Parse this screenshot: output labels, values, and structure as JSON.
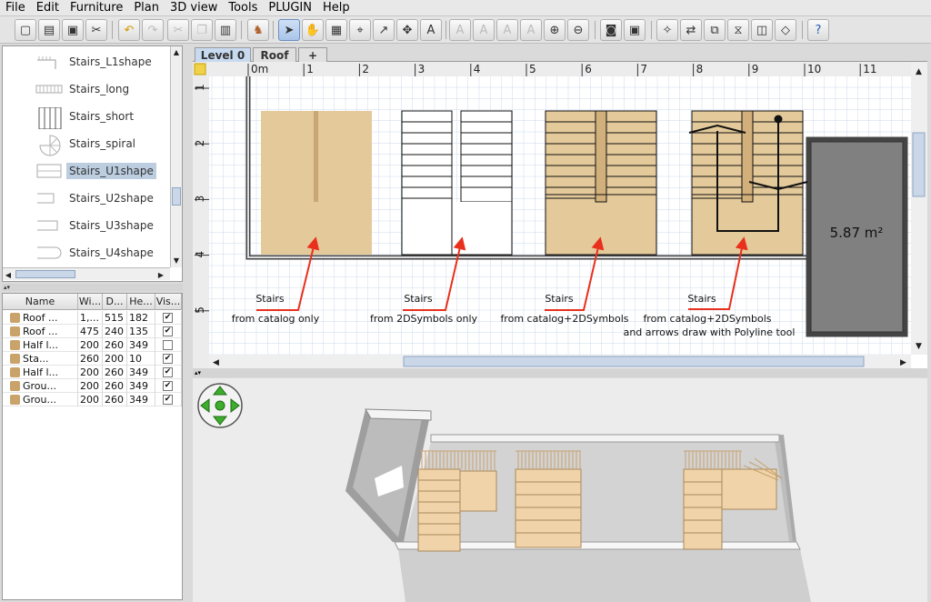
{
  "menu": [
    "File",
    "Edit",
    "Furniture",
    "Plan",
    "3D view",
    "Tools",
    "PLUGIN",
    "Help"
  ],
  "toolbar_icons": [
    "new-file-icon",
    "open-icon",
    "save-icon",
    "cut-preferences-icon",
    "undo-icon",
    "redo-icon",
    "cut-icon",
    "copy-icon",
    "paste-icon",
    "add-furniture-icon",
    "select-arrow-icon",
    "pan-hand-icon",
    "create-rooms-icon",
    "create-polylines-icon",
    "create-dimension-icon",
    "create-labels-icon",
    "add-text-icon",
    "text-bold-icon",
    "text-italic-icon",
    "enlarge-text-icon",
    "reduce-text-icon",
    "zoom-in-icon",
    "zoom-out-icon",
    "create-photo-icon",
    "create-video-icon",
    "import-furniture-icon",
    "import-texture-icon",
    "flip-icon",
    "mirror-icon",
    "import-background-icon",
    "export-icon",
    "help-icon"
  ],
  "catalog": {
    "items": [
      "Stairs_L1shape",
      "Stairs_long",
      "Stairs_short",
      "Stairs_spiral",
      "Stairs_U1shape",
      "Stairs_U2shape",
      "Stairs_U3shape",
      "Stairs_U4shape"
    ],
    "selected": "Stairs_U1shape"
  },
  "furniture_table": {
    "headers": [
      "Name",
      "Wi...",
      "D...",
      "He...",
      "Vis..."
    ],
    "rows": [
      {
        "name": "Roof ...",
        "w": "1,...",
        "d": "515",
        "h": "182",
        "visible": true
      },
      {
        "name": "Roof ...",
        "w": "475",
        "d": "240",
        "h": "135",
        "visible": true
      },
      {
        "name": "Half l...",
        "w": "200",
        "d": "260",
        "h": "349",
        "visible": false
      },
      {
        "name": "Sta...",
        "w": "260",
        "d": "200",
        "h": "10",
        "visible": true
      },
      {
        "name": "Half l...",
        "w": "200",
        "d": "260",
        "h": "349",
        "visible": true
      },
      {
        "name": "Grou...",
        "w": "200",
        "d": "260",
        "h": "349",
        "visible": true
      },
      {
        "name": "Grou...",
        "w": "200",
        "d": "260",
        "h": "349",
        "visible": true
      }
    ]
  },
  "plan": {
    "tabs": [
      "Level 0",
      "Roof",
      "+"
    ],
    "ruler_x": [
      "0m",
      "1",
      "2",
      "3",
      "4",
      "5",
      "6",
      "7",
      "8",
      "9",
      "10",
      "11"
    ],
    "ruler_y": [
      "1",
      "2",
      "3",
      "4",
      "5"
    ],
    "room_area": "5.87 m²",
    "annotations": [
      {
        "title": "Stairs",
        "line1": "from catalog only",
        "line2": ""
      },
      {
        "title": "Stairs",
        "line1": "from 2DSymbols only",
        "line2": ""
      },
      {
        "title": "Stairs",
        "line1": "from catalog+2DSymbols",
        "line2": ""
      },
      {
        "title": "Stairs",
        "line1": "from catalog+2DSymbols",
        "line2": "and arrows draw with Polyline tool"
      }
    ],
    "colors": {
      "grid": "#c9d8ea",
      "wood": "#e4c99a",
      "room": "#808080",
      "arrow": "#e8301c"
    }
  }
}
